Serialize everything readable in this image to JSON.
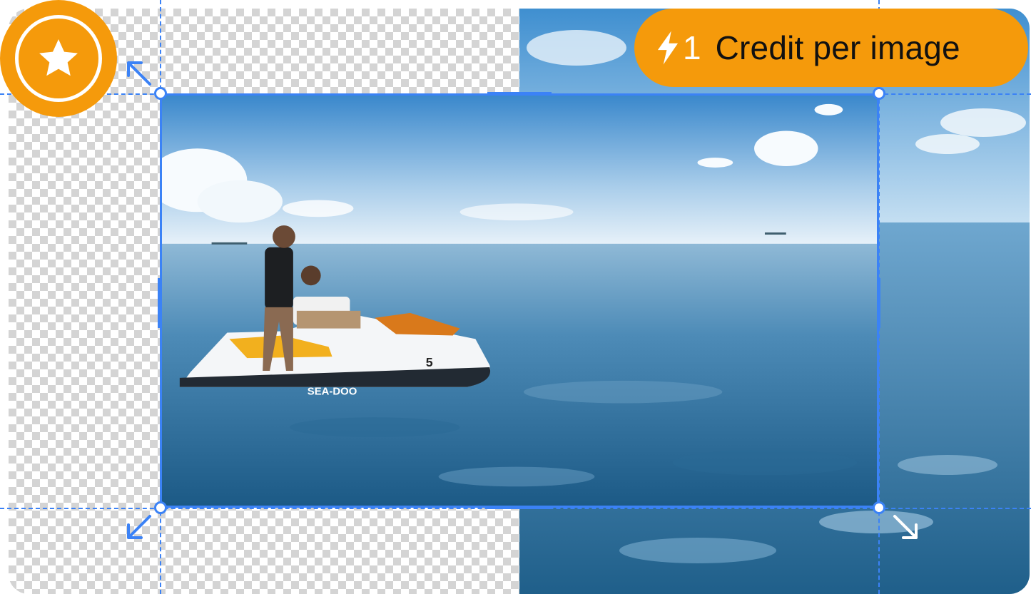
{
  "badge": {
    "icon": "star-icon",
    "color": "#f59a0b"
  },
  "credit": {
    "icon": "lightning-bolt-icon",
    "count": "1",
    "label": "Credit per image",
    "color": "#f59a0b"
  },
  "editor": {
    "transparent_area": "checkerboard",
    "guide_color": "#3b82f6",
    "photo_number": "5",
    "photo_brand": "SEA-DOO"
  }
}
